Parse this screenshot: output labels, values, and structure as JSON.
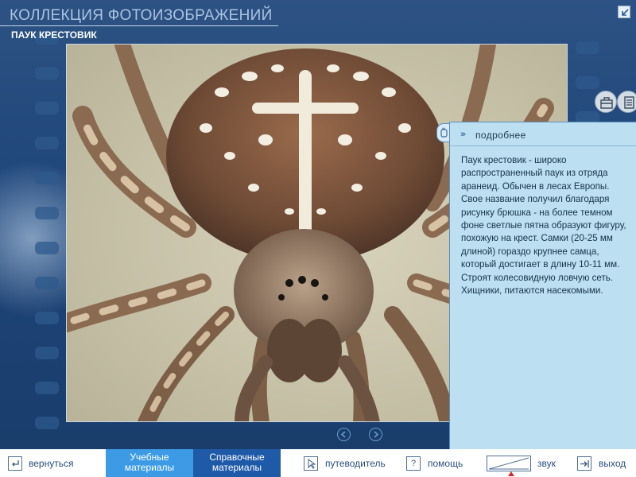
{
  "window": {
    "app_title": "КОЛЛЕКЦИЯ ФОТОИЗОБРАЖЕНИЙ",
    "subject_title": "ПАУК КРЕСТОВИК"
  },
  "info_panel": {
    "chevrons": "›››",
    "heading": "подробнее",
    "text": "Паук крестовик - широко распространенный паук из отряда аранеид. Обычен в лесах Европы. Свое название получил благодаря рисунку брюшка - на более темном фоне светлые пятна образуют фигуру, похожую на крест. Самки (20-25 мм длиной) гораздо крупнее самца, который достигает в длину 10-11 мм. Строят колесовидную ловчую сеть. Хищники, питаются насекомыми."
  },
  "bottom_bar": {
    "back_label": "вернуться",
    "tab_study_line1": "Учебные",
    "tab_study_line2": "материалы",
    "tab_reference_line1": "Справочные",
    "tab_reference_line2": "материалы",
    "guide_label": "путеводитель",
    "help_icon_text": "?",
    "help_label": "помощь",
    "sound_label": "звук",
    "exit_label": "выход"
  },
  "volume": {
    "level": 0.55
  },
  "icons": {
    "corner": "restore-arrow-icon",
    "prev": "arrow-left-icon",
    "next": "arrow-right-icon",
    "tool1": "toolbox-icon",
    "tool2": "document-icon",
    "panel_tab": "hand-pointer-icon",
    "back": "return-arrow-icon",
    "guide": "cursor-icon",
    "help": "question-icon",
    "exit": "exit-arrow-icon"
  },
  "colors": {
    "background": "#1f467a",
    "panel": "#bcdff1",
    "tab_active": "#3d9be6",
    "tab_normal": "#1f5aa8",
    "header_text": "#aac4e2",
    "volume_marker": "#d62828"
  }
}
